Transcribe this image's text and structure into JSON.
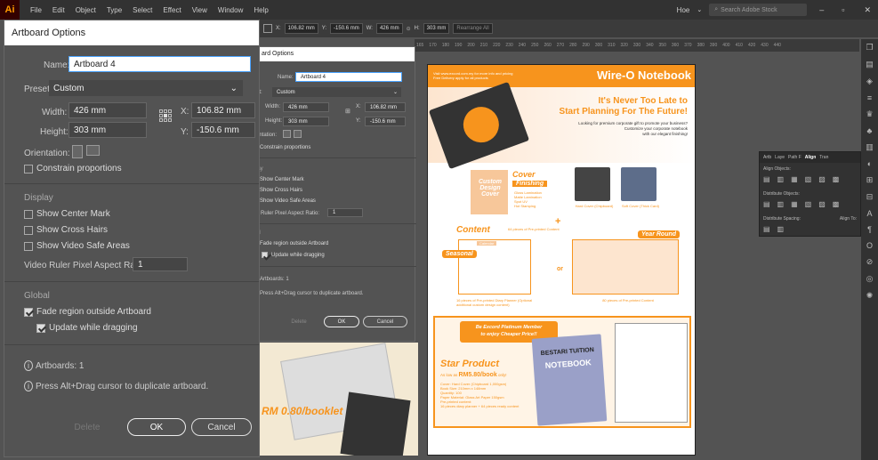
{
  "menubar": {
    "logo": "Ai",
    "items": [
      "File",
      "Edit",
      "Object",
      "Type",
      "Select",
      "Effect",
      "View",
      "Window",
      "Help"
    ],
    "workspace": "Hoe",
    "search_placeholder": "Search Adobe Stock"
  },
  "control_bar": {
    "x_label": "X:",
    "x_value": "106.82 mm",
    "y_label": "Y:",
    "y_value": "-150.6 mm",
    "w_label": "W:",
    "w_value": "426 mm",
    "h_label": "H:",
    "h_value": "303 mm",
    "rearrange": "Rearrange All"
  },
  "ruler": {
    "ticks": [
      "165",
      "170",
      "180",
      "190",
      "200",
      "210",
      "220",
      "230",
      "240",
      "250",
      "260",
      "270",
      "280",
      "290",
      "300",
      "310",
      "320",
      "330",
      "340",
      "350",
      "360",
      "370",
      "380",
      "390",
      "400",
      "410",
      "420",
      "430",
      "440"
    ]
  },
  "dialog": {
    "title": "Artboard Options",
    "name_label": "Name:",
    "name_value": "Artboard 4",
    "preset_label": "Preset:",
    "preset_value": "Custom",
    "width_label": "Width:",
    "width_value": "426 mm",
    "height_label": "Height:",
    "height_value": "303 mm",
    "x_label": "X:",
    "x_value": "106.82 mm",
    "y_label": "Y:",
    "y_value": "-150.6 mm",
    "orientation_label": "Orientation:",
    "constrain": "Constrain proportions",
    "display_header": "Display",
    "show_center_mark": "Show Center Mark",
    "show_cross_hairs": "Show Cross Hairs",
    "show_video_safe": "Show Video Safe Areas",
    "video_ratio_label": "Video Ruler Pixel Aspect Ratio:",
    "video_ratio_value": "1",
    "global_header": "Global",
    "fade_region": "Fade region outside Artboard",
    "update_dragging": "Update while dragging",
    "artboards_info": "Artboards: 1",
    "alt_drag_info": "Press Alt+Drag cursor to duplicate artboard.",
    "delete_label": "Delete",
    "ok_label": "OK",
    "cancel_label": "Cancel"
  },
  "dialog_small": {
    "title": "ard Options",
    "name_label": "Name:",
    "name_value": "Artboard 4",
    "preset_label": "et:",
    "preset_value": "Custom",
    "width_label": "Width:",
    "width_value": "426 mm",
    "height_label": "Height:",
    "height_value": "303 mm",
    "x_label": "X:",
    "x_value": "106.82 mm",
    "y_label": "Y:",
    "y_value": "-150.6 mm",
    "orientation_label": "entation:",
    "constrain": "Constrain proportions",
    "display_header": "lay",
    "show_center_mark": "Show Center Mark",
    "show_cross_hairs": "Show Cross Hairs",
    "show_video_safe": "Show Video Safe Areas",
    "video_ratio_label": "o Ruler Pixel Aspect Ratio:",
    "video_ratio_value": "1",
    "global_header": "al",
    "fade_region": "Fade region outside Artboard",
    "update_dragging": "Update while dragging",
    "artboards_info": "Artboards: 1",
    "alt_drag_info": "Press Alt+Drag cursor to duplicate artboard.",
    "delete_label": "Delete",
    "ok_label": "OK",
    "cancel_label": "Cancel"
  },
  "align_panel": {
    "tabs": [
      "Artb",
      "Laye",
      "Path F",
      "Align",
      "Tran"
    ],
    "align_objects": "Align Objects:",
    "distribute_objects": "Distribute Objects:",
    "distribute_spacing": "Distribute Spacing:",
    "align_to": "Align To:"
  },
  "page_left": {
    "price": "RM 0.80/booklet"
  },
  "flyer": {
    "bullets": [
      "Visit www.excord.com.my for more info and pricing",
      "Free Delivery apply for all products"
    ],
    "brand": "Wire-O Notebook",
    "headline_1": "It's Never Too Late to",
    "headline_2": "Start Planning For The Future!",
    "subtext_1": "Looking for premium corporate gift to promote your business?",
    "subtext_2": "Customize your corporate notebook",
    "subtext_3": "with our elegant finishing!",
    "custom_design": "Custom Design Cover",
    "cover_finishing_1": "Cover",
    "cover_finishing_2": "Finishing",
    "finishing_items": [
      "Gloss Lamination",
      "Matte Lamination",
      "Spot UV",
      "Hot Stamping"
    ],
    "hard_cover": "Hard Cover (Chipboard)",
    "soft_cover": "Soft Cover (Thick Card)",
    "content": "Content",
    "seasonal": "Seasonal",
    "calendar": "Calendar",
    "pieces_64": "64 pieces of Pre-printed Content",
    "or": "or",
    "year_round": "Year Round",
    "planner_16": "16 pieces of Pre-printed Diary Planner (Optional additional custom design content)",
    "content_80": "80 pieces of Pre-printed Content",
    "member_1": "Be Excord Platinum Member",
    "member_2": "to enjoy Cheaper Price!!",
    "star_product": "Star Product",
    "as_low_as": "As low as",
    "price_star": "RM5.80/book",
    "only": "only!",
    "specs": [
      "Cover: Hard Cover (Chipboard 1,000gsm)",
      "Book Size: 210mm x 148mm",
      "Quantity: 100",
      "Paper Material: Glass Art Paper 150gsm",
      "Pre-printed content:",
      "16 pieces diary planner + 64 pieces ready content"
    ],
    "nb_brand": "BESTARI TUITION",
    "nb_title": "NOTEBOOK"
  }
}
